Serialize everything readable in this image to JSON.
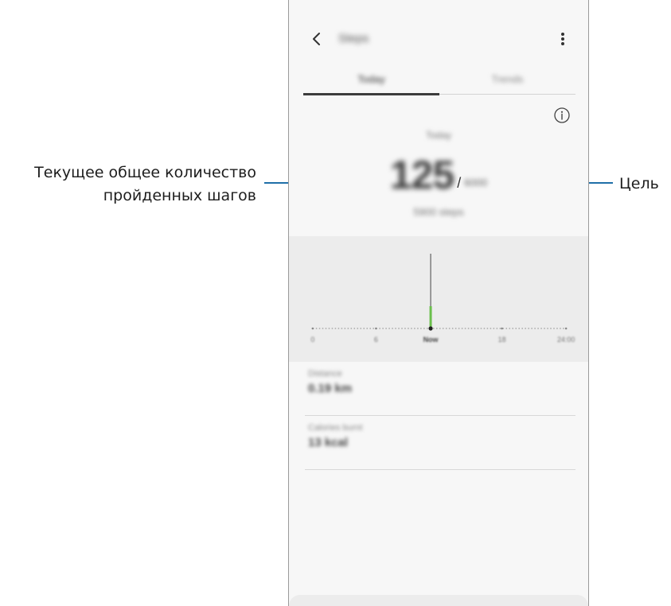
{
  "callouts": {
    "left_line1": "Текущее общее количество",
    "left_line2": "пройденных шагов",
    "right": "Цель"
  },
  "app": {
    "title": "Steps",
    "back_icon": "chevron-left-icon",
    "more_icon": "more-vert-icon",
    "info_icon": "info-icon"
  },
  "tabs": [
    {
      "label": "Today",
      "active": true
    },
    {
      "label": "Trends",
      "active": false
    }
  ],
  "summary": {
    "label": "Today",
    "steps": "125",
    "slash": "/",
    "goal": "6000",
    "sub": "5900 steps"
  },
  "chart": {
    "x_labels": [
      "0",
      "6",
      "Now",
      "18",
      "24:00"
    ],
    "bar_color": "#6abf4b"
  },
  "chart_data": {
    "type": "bar",
    "categories": [
      "0",
      "6",
      "Now",
      "18",
      "24:00"
    ],
    "values": [
      0,
      0,
      125,
      0,
      0
    ]
  },
  "stats": [
    {
      "label": "Distance",
      "value": "0.19 km"
    },
    {
      "label": "Calories burnt",
      "value": "13 kcal"
    }
  ],
  "colors": {
    "leader_line": "#1f6fa8",
    "screen_bg": "#f7f7f7",
    "chart_bg": "#ececec"
  }
}
